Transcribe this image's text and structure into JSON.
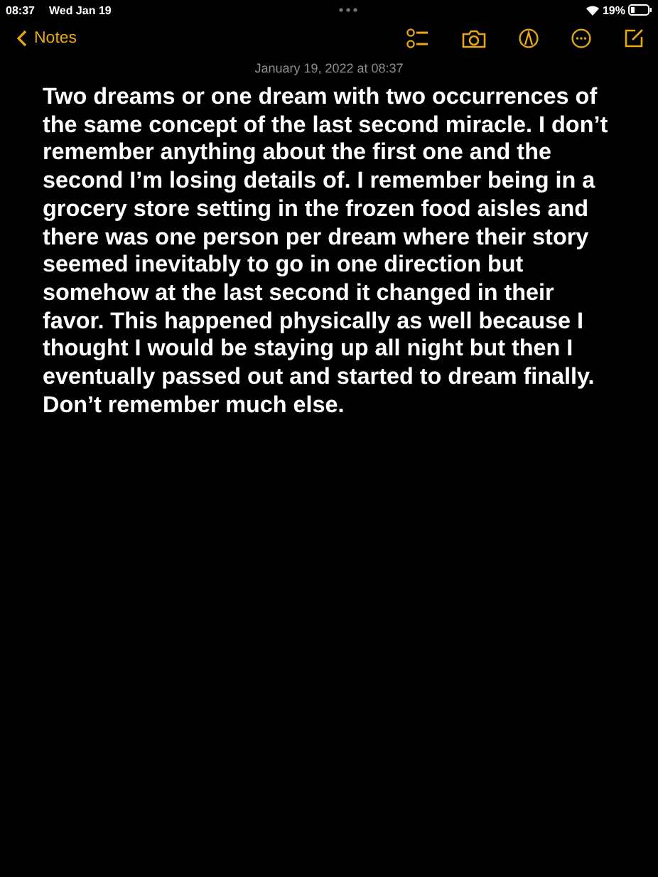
{
  "status_bar": {
    "time": "08:37",
    "date": "Wed Jan 19",
    "battery": "19%"
  },
  "nav": {
    "back_label": "Notes"
  },
  "note": {
    "timestamp": "January 19, 2022 at 08:37",
    "body": "Two dreams or one dream with two occurrences of the same concept of the last second miracle. I don’t remember anything about the first one and the second I’m losing details of. I remember being in a grocery store setting in the frozen food aisles and there was one person per dream where their story seemed inevitably to go in one direction but somehow at the last second it changed in their favor. This happened physically as well because I thought I would be staying up all night but then I eventually passed out and started to dream finally. Don’t remember much else."
  }
}
